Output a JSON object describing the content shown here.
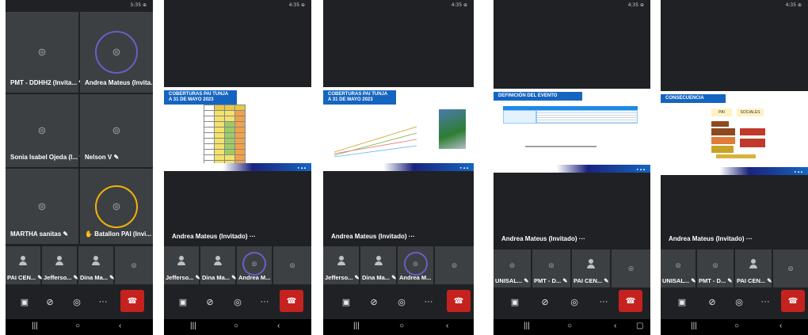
{
  "phones": [
    {
      "status": "5:35 ⊕",
      "tiles": [
        {
          "name": "PMT - DDHH2 (Invita... ✎",
          "ring": ""
        },
        {
          "name": "Andrea Mateus (Invita...",
          "ring": "#6d5cc4"
        },
        {
          "name": "Sonia Isabel Ojeda (I... ✎",
          "ring": ""
        },
        {
          "name": "Nelson V ✎",
          "ring": ""
        },
        {
          "name": "MARTHA sanitas ✎",
          "ring": ""
        },
        {
          "name": "✋ Batallon PAI (Invi... ✎",
          "ring": "#f3b10d"
        }
      ],
      "strip": [
        "PAI CEN... ✎",
        "Jefferso... ✎",
        "Dina Ma... ✎",
        ""
      ]
    },
    {
      "status": "4:35 ⊕",
      "slide_title": "COBERTURAS PAI TUNJA A 31 DE MAYO 2023",
      "presenter": "Andrea Mateus (Invitado) ···",
      "strip": [
        "Jefferso... ✎",
        "Dina Ma... ✎",
        "Andrea M...",
        ""
      ]
    },
    {
      "status": "4:35 ⊕",
      "slide_title": "COBERTURAS PAI TUNJA A 31 DE MAYO 2023",
      "presenter": "Andrea Mateus (Invitado) ···",
      "strip": [
        "Jefferso... ✎",
        "Dina Ma... ✎",
        "Andrea M...",
        ""
      ]
    },
    {
      "status": "4:35 ⊕",
      "slide_title": "DEFINICIÓN DEL EVENTO",
      "presenter": "Andrea Mateus (Invitado) ···",
      "strip": [
        "UNISAL... ✎",
        "PMT - D... ✎",
        "PAI CEN... ✎",
        ""
      ]
    },
    {
      "status": "4:35 ⊕",
      "slide_title": "CONSECUENCIA",
      "presenter": "Andrea Mateus (Invitado) ···",
      "strip": [
        "UNISAL... ✎",
        "PMT - D... ✎",
        "PAI CEN... ✎",
        ""
      ],
      "boxes": [
        "PAI",
        "SOCIALES"
      ]
    }
  ],
  "colors": {
    "bg": "#202124",
    "tile": "#3c4043",
    "hangup": "#c5221f",
    "slide_blue": "#1565c0"
  },
  "icons": [
    "camera-off-icon",
    "mic-off-icon",
    "audio-icon",
    "more-icon",
    "hangup-icon"
  ]
}
